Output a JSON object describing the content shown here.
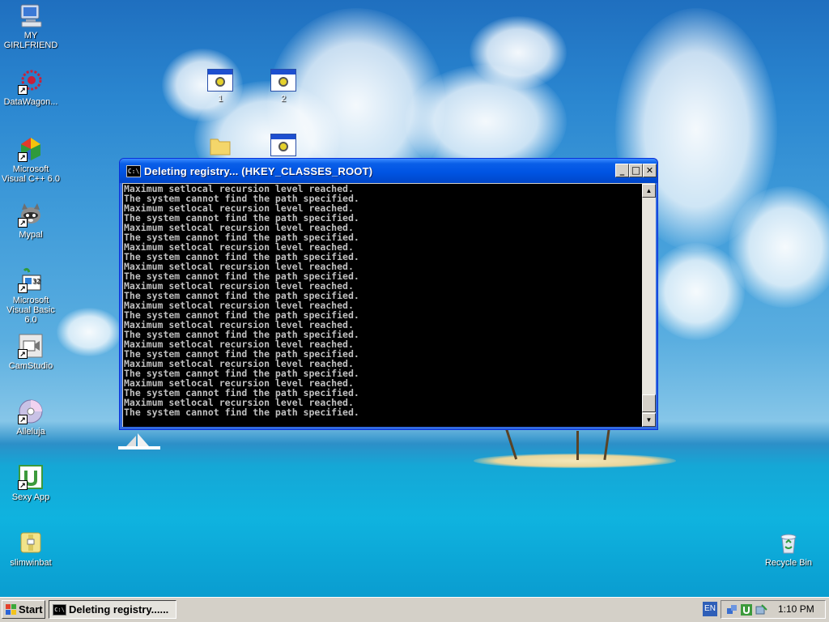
{
  "desktop": {
    "icons": [
      {
        "label": "MY GIRLFRIEND"
      },
      {
        "label": "DataWagon..."
      },
      {
        "label": "Microsoft Visual C++ 6.0"
      },
      {
        "label": "Mypal"
      },
      {
        "label": "Microsoft Visual Basic 6.0"
      },
      {
        "label": "CamStudio"
      },
      {
        "label": "Alleluja"
      },
      {
        "label": "Sexy App"
      },
      {
        "label": "slimwinbat"
      },
      {
        "label": "Recycle Bin"
      }
    ],
    "files": [
      {
        "label": "1"
      },
      {
        "label": "2"
      }
    ]
  },
  "window": {
    "title": "Deleting registry... (HKEY_CLASSES_ROOT)",
    "app_icon_text": "C:\\",
    "minimize": "_",
    "maximize": "□",
    "close": "✕",
    "console_lines": [
      "Maximum setlocal recursion level reached.",
      "The system cannot find the path specified.",
      "Maximum setlocal recursion level reached.",
      "The system cannot find the path specified.",
      "Maximum setlocal recursion level reached.",
      "The system cannot find the path specified.",
      "Maximum setlocal recursion level reached.",
      "The system cannot find the path specified.",
      "Maximum setlocal recursion level reached.",
      "The system cannot find the path specified.",
      "Maximum setlocal recursion level reached.",
      "The system cannot find the path specified.",
      "Maximum setlocal recursion level reached.",
      "The system cannot find the path specified.",
      "Maximum setlocal recursion level reached.",
      "The system cannot find the path specified.",
      "Maximum setlocal recursion level reached.",
      "The system cannot find the path specified.",
      "Maximum setlocal recursion level reached.",
      "The system cannot find the path specified.",
      "Maximum setlocal recursion level reached.",
      "The system cannot find the path specified.",
      "Maximum setlocal recursion level reached.",
      "The system cannot find the path specified."
    ]
  },
  "taskbar": {
    "start_label": "Start",
    "task_label": "Deleting registry......",
    "task_icon_text": "C:\\",
    "language": "EN",
    "clock": "1:10 PM"
  },
  "icons": {
    "computer": "my-computer-icon",
    "folder": "folder-icon",
    "recycle": "recycle-bin-icon"
  }
}
